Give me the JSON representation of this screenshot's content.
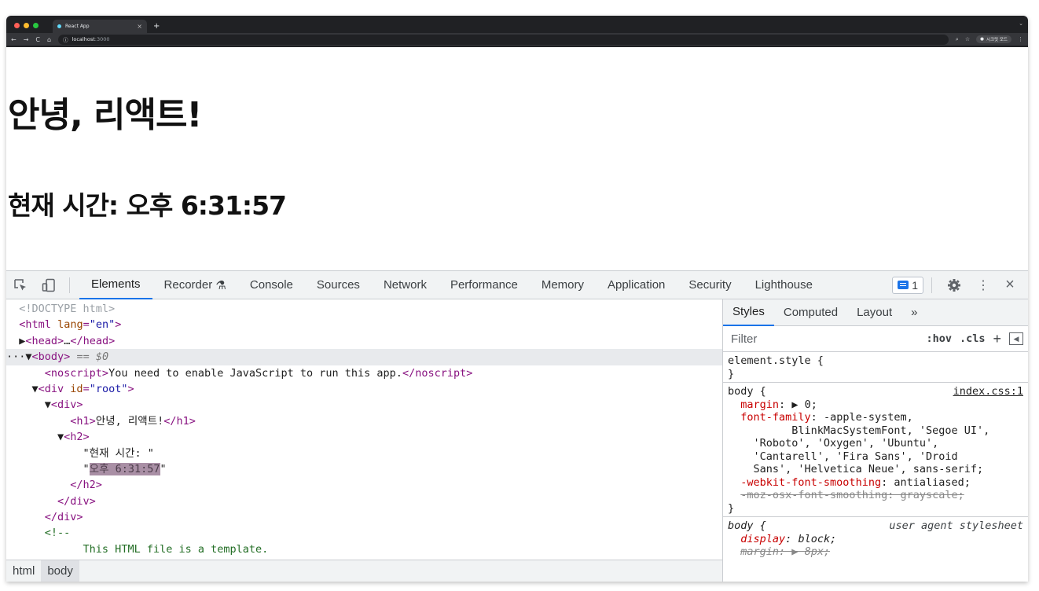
{
  "browser": {
    "tab_title": "React App",
    "url_host": "localhost",
    "url_port": ":3000",
    "profile_label": "시크릿 모드",
    "colors": {
      "close": "#ff5f57",
      "minimize": "#febc2e",
      "maximize": "#28c840"
    }
  },
  "page": {
    "h1": "안녕, 리액트!",
    "h2": "현재 시간: 오후 6:31:57"
  },
  "devtools": {
    "tabs": [
      "Elements",
      "Recorder",
      "Console",
      "Sources",
      "Network",
      "Performance",
      "Memory",
      "Application",
      "Security",
      "Lighthouse"
    ],
    "recorder_icon": "flask-icon",
    "issues_count": "1",
    "elements_tree": {
      "doctype": "<!DOCTYPE html>",
      "html_open": "html",
      "html_lang_attr": "lang",
      "html_lang_val": "\"en\"",
      "head_collapsed": "…",
      "body_suffix": " == $0",
      "noscript_text": "You need to enable JavaScript to run this app.",
      "div_id_attr": "id",
      "div_id_val": "\"root\"",
      "h1_text": "안녕, 리액트!",
      "h2_text_1": "\"현재 시간: \"",
      "h2_text_2": "오후 6:31:57",
      "comment_open": "<!--",
      "comment_text": "This HTML file is a template."
    },
    "breadcrumbs": [
      "html",
      "body"
    ],
    "styles_tabs": [
      "Styles",
      "Computed",
      "Layout",
      "»"
    ],
    "filter_placeholder": "Filter",
    "hov_label": ":hov",
    "cls_label": ".cls",
    "element_style": "element.style {",
    "rule_close": "}",
    "body_rule": {
      "selector": "body {",
      "source": "index.css:1",
      "margin_prop": "margin",
      "margin_val": "0;",
      "ff_prop": "font-family",
      "ff_val_lines": [
        "-apple-system,",
        "    BlinkMacSystemFont, 'Segoe UI',",
        "  'Roboto', 'Oxygen', 'Ubuntu',",
        "  'Cantarell', 'Fira Sans', 'Droid",
        "  Sans', 'Helvetica Neue', sans-serif;"
      ],
      "wk_prop": "-webkit-font-smoothing",
      "wk_val": "antialiased;",
      "moz_line": "-moz-osx-font-smoothing: grayscale;"
    },
    "ua_rule": {
      "selector": "body {",
      "source": "user agent stylesheet",
      "display_prop": "display",
      "display_val": "block;",
      "margin_prop": "margin",
      "margin_val": "8px;"
    }
  }
}
